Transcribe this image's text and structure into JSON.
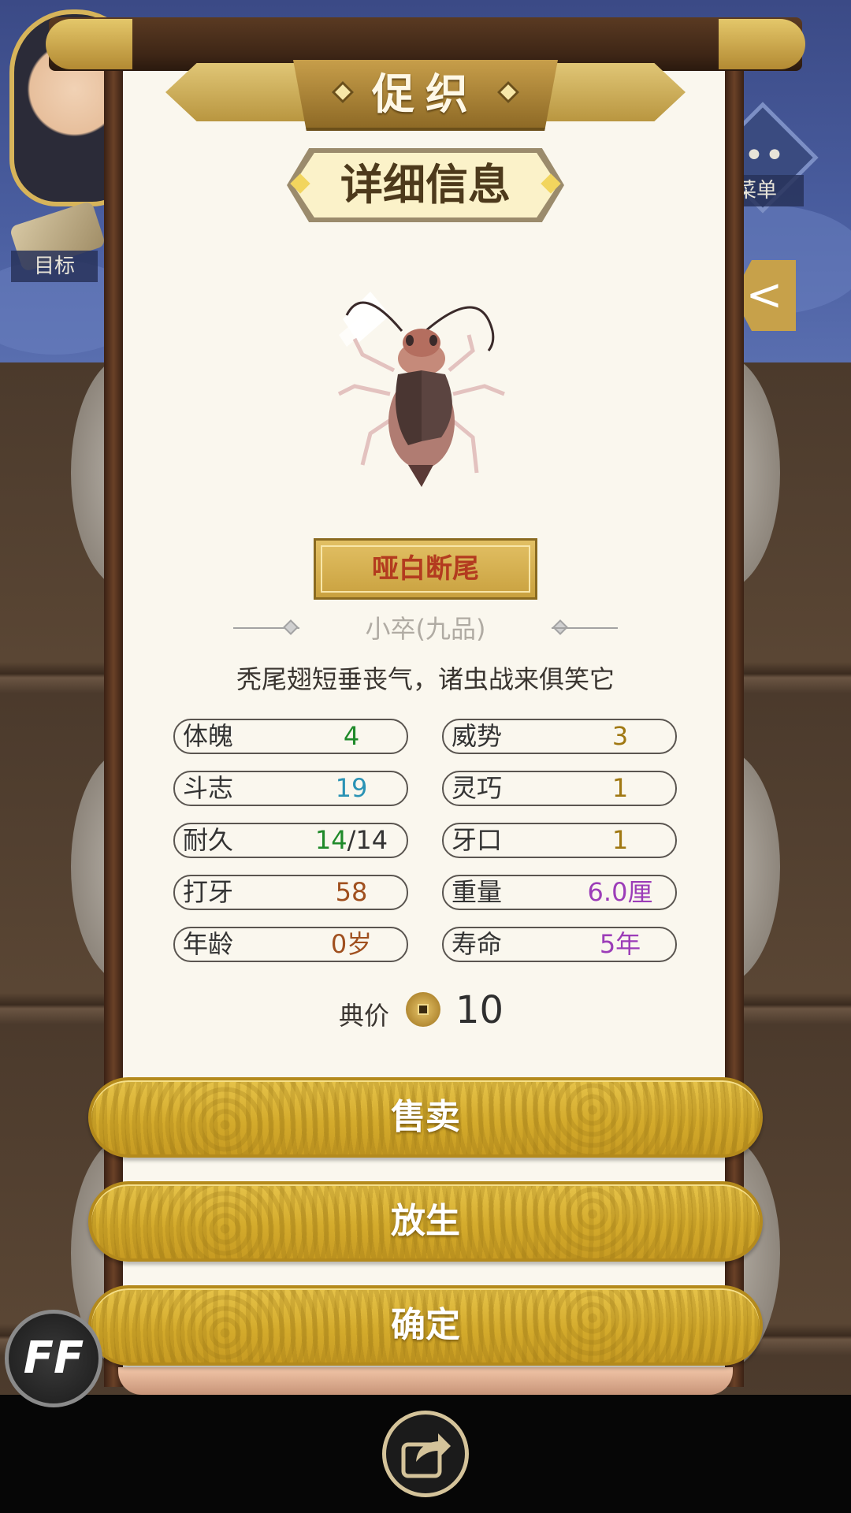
{
  "header": {
    "title": "促织",
    "detail_heading": "详细信息"
  },
  "hud": {
    "goal_label": "目标",
    "menu_label": "菜单",
    "menu_dots": "••",
    "back_glyph": "<"
  },
  "cricket": {
    "name": "哑白断尾",
    "rank": "小卒(九品)",
    "description": "秃尾翅短垂丧气，诸虫战来俱笑它",
    "stats": [
      {
        "label": "体魄",
        "value": "4",
        "color": "#1f8a2a"
      },
      {
        "label": "威势",
        "value": "3",
        "color": "#a07812"
      },
      {
        "label": "斗志",
        "value": "19",
        "color": "#2a93b5"
      },
      {
        "label": "灵巧",
        "value": "1",
        "color": "#a07812"
      },
      {
        "label": "耐久",
        "value_main": "14",
        "value_sep": "/14",
        "color": "#1f8a2a"
      },
      {
        "label": "牙口",
        "value": "1",
        "color": "#a07812"
      },
      {
        "label": "打牙",
        "value": "58",
        "color": "#a0501f"
      },
      {
        "label": "重量",
        "value": "6.0厘",
        "color": "#9c3db8"
      },
      {
        "label": "年龄",
        "value": "0岁",
        "color": "#a0501f"
      },
      {
        "label": "寿命",
        "value": "5年",
        "color": "#9c3db8"
      }
    ],
    "price_label": "典价",
    "price_value": "10"
  },
  "actions": {
    "sell": "售卖",
    "release": "放生",
    "confirm": "确定"
  },
  "overlay": {
    "ff_label": "FF"
  },
  "icons": {
    "coin": "coin-icon",
    "share": "share-icon",
    "goal": "scroll-icon",
    "menu": "menu-icon"
  }
}
